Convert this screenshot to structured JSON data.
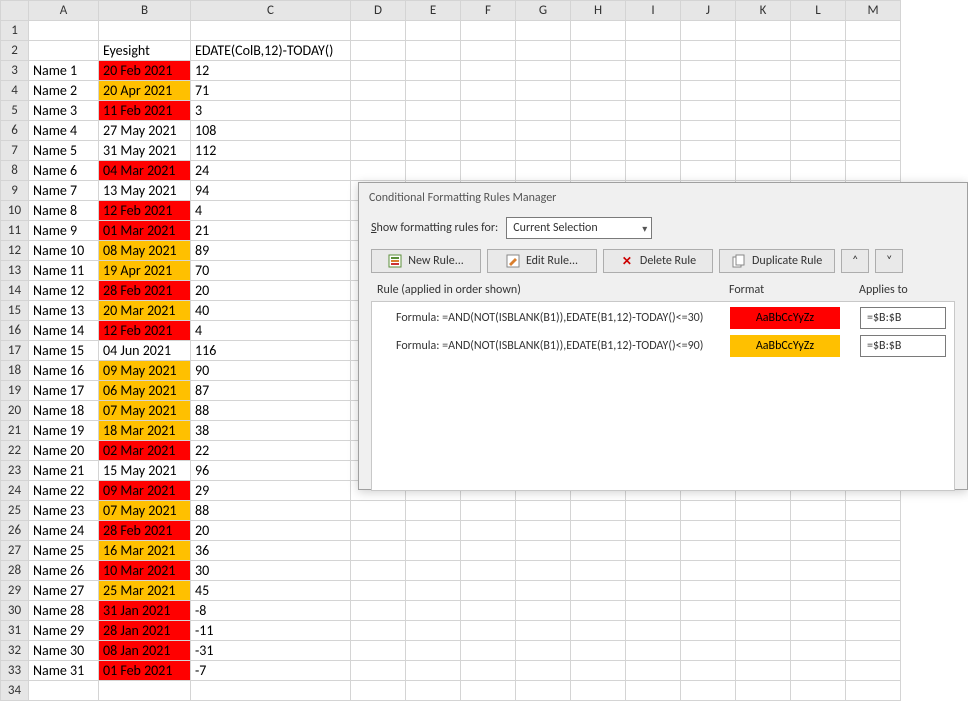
{
  "columns": [
    "A",
    "B",
    "C",
    "D",
    "E",
    "F",
    "G",
    "H",
    "I",
    "J",
    "K",
    "L",
    "M"
  ],
  "headerRow": {
    "B": "Eyesight",
    "C": "EDATE(ColB,12)-TODAY()"
  },
  "rows": [
    {
      "n": 1
    },
    {
      "n": 2,
      "A": "",
      "B_header": true,
      "C_header": true
    },
    {
      "n": 3,
      "A": "Name 1",
      "B": "20 Feb 2021",
      "C": "12",
      "hl": "red"
    },
    {
      "n": 4,
      "A": "Name 2",
      "B": "20 Apr 2021",
      "C": "71",
      "hl": "amber"
    },
    {
      "n": 5,
      "A": "Name 3",
      "B": "11 Feb 2021",
      "C": "3",
      "hl": "red"
    },
    {
      "n": 6,
      "A": "Name 4",
      "B": "27 May 2021",
      "C": "108",
      "hl": ""
    },
    {
      "n": 7,
      "A": "Name 5",
      "B": "31 May 2021",
      "C": "112",
      "hl": ""
    },
    {
      "n": 8,
      "A": "Name 6",
      "B": "04 Mar 2021",
      "C": "24",
      "hl": "red"
    },
    {
      "n": 9,
      "A": "Name 7",
      "B": "13 May 2021",
      "C": "94",
      "hl": ""
    },
    {
      "n": 10,
      "A": "Name 8",
      "B": "12 Feb 2021",
      "C": "4",
      "hl": "red"
    },
    {
      "n": 11,
      "A": "Name 9",
      "B": "01 Mar 2021",
      "C": "21",
      "hl": "red"
    },
    {
      "n": 12,
      "A": "Name 10",
      "B": "08 May 2021",
      "C": "89",
      "hl": "amber"
    },
    {
      "n": 13,
      "A": "Name 11",
      "B": "19 Apr 2021",
      "C": "70",
      "hl": "amber"
    },
    {
      "n": 14,
      "A": "Name 12",
      "B": "28 Feb 2021",
      "C": "20",
      "hl": "red"
    },
    {
      "n": 15,
      "A": "Name 13",
      "B": "20 Mar 2021",
      "C": "40",
      "hl": "amber"
    },
    {
      "n": 16,
      "A": "Name 14",
      "B": "12 Feb 2021",
      "C": "4",
      "hl": "red"
    },
    {
      "n": 17,
      "A": "Name 15",
      "B": "04 Jun 2021",
      "C": "116",
      "hl": ""
    },
    {
      "n": 18,
      "A": "Name 16",
      "B": "09 May 2021",
      "C": "90",
      "hl": "amber"
    },
    {
      "n": 19,
      "A": "Name 17",
      "B": "06 May 2021",
      "C": "87",
      "hl": "amber"
    },
    {
      "n": 20,
      "A": "Name 18",
      "B": "07 May 2021",
      "C": "88",
      "hl": "amber"
    },
    {
      "n": 21,
      "A": "Name 19",
      "B": "18 Mar 2021",
      "C": "38",
      "hl": "amber"
    },
    {
      "n": 22,
      "A": "Name 20",
      "B": "02 Mar 2021",
      "C": "22",
      "hl": "red"
    },
    {
      "n": 23,
      "A": "Name 21",
      "B": "15 May 2021",
      "C": "96",
      "hl": ""
    },
    {
      "n": 24,
      "A": "Name 22",
      "B": "09 Mar 2021",
      "C": "29",
      "hl": "red"
    },
    {
      "n": 25,
      "A": "Name 23",
      "B": "07 May 2021",
      "C": "88",
      "hl": "amber"
    },
    {
      "n": 26,
      "A": "Name 24",
      "B": "28 Feb 2021",
      "C": "20",
      "hl": "red"
    },
    {
      "n": 27,
      "A": "Name 25",
      "B": "16 Mar 2021",
      "C": "36",
      "hl": "amber"
    },
    {
      "n": 28,
      "A": "Name 26",
      "B": "10 Mar 2021",
      "C": "30",
      "hl": "red"
    },
    {
      "n": 29,
      "A": "Name 27",
      "B": "25 Mar 2021",
      "C": "45",
      "hl": "amber"
    },
    {
      "n": 30,
      "A": "Name 28",
      "B": "31 Jan 2021",
      "C": "-8",
      "hl": "red"
    },
    {
      "n": 31,
      "A": "Name 29",
      "B": "28 Jan 2021",
      "C": "-11",
      "hl": "red"
    },
    {
      "n": 32,
      "A": "Name 30",
      "B": "08 Jan 2021",
      "C": "-31",
      "hl": "red"
    },
    {
      "n": 33,
      "A": "Name 31",
      "B": "01 Feb 2021",
      "C": "-7",
      "hl": "red"
    },
    {
      "n": 34
    }
  ],
  "dialog": {
    "title": "Conditional Formatting Rules Manager",
    "showLabel": "Show formatting rules for:",
    "showValue": "Current Selection",
    "buttons": {
      "new": "New Rule...",
      "edit": "Edit Rule...",
      "delete": "Delete Rule",
      "duplicate": "Duplicate Rule"
    },
    "listHeader": {
      "rule": "Rule (applied in order shown)",
      "format": "Format",
      "applies": "Applies to"
    },
    "rules": [
      {
        "formula": "Formula: =AND(NOT(ISBLANK(B1)),EDATE(B1,12)-TODAY()<=30)",
        "preview": "AaBbCcYyZz",
        "previewClass": "red",
        "applies": "=$B:$B"
      },
      {
        "formula": "Formula: =AND(NOT(ISBLANK(B1)),EDATE(B1,12)-TODAY()<=90)",
        "preview": "AaBbCcYyZz",
        "previewClass": "amber",
        "applies": "=$B:$B"
      }
    ]
  }
}
